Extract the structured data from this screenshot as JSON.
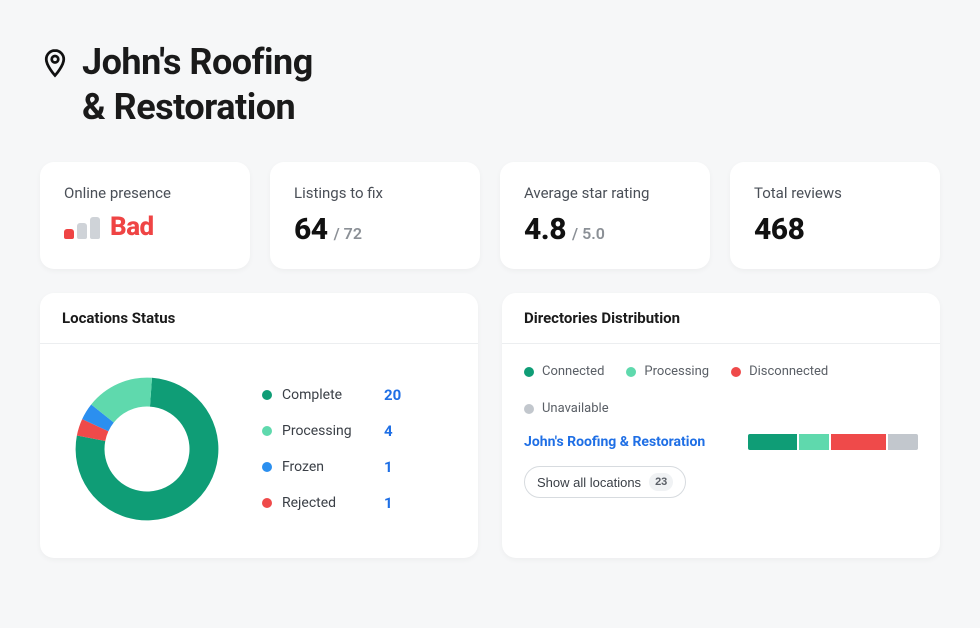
{
  "business": {
    "name_line1": "John's Roofing",
    "name_line2": "& Restoration"
  },
  "stats": {
    "online_presence": {
      "label": "Online presence",
      "status": "Bad"
    },
    "listings_to_fix": {
      "label": "Listings to fix",
      "value": "64",
      "of": "/ 72"
    },
    "avg_star": {
      "label": "Average star rating",
      "value": "4.8",
      "of": "/ 5.0"
    },
    "total_reviews": {
      "label": "Total reviews",
      "value": "468"
    }
  },
  "locations_status": {
    "title": "Locations Status",
    "items": [
      {
        "label": "Complete",
        "value": "20",
        "color": "#0f9d76"
      },
      {
        "label": "Processing",
        "value": "4",
        "color": "#5fd9ad"
      },
      {
        "label": "Frozen",
        "value": "1",
        "color": "#2b8fef"
      },
      {
        "label": "Rejected",
        "value": "1",
        "color": "#ef4a4a"
      }
    ]
  },
  "directories": {
    "title": "Directories Distribution",
    "legend": [
      {
        "label": "Connected",
        "color": "#0f9d76"
      },
      {
        "label": "Processing",
        "color": "#5fd9ad"
      },
      {
        "label": "Disconnected",
        "color": "#ef4a4a"
      },
      {
        "label": "Unavailable",
        "color": "#c2c7cd"
      }
    ],
    "row": {
      "name": "John's Roofing & Restoration",
      "segments": [
        {
          "color": "#0f9d76",
          "weight": 30
        },
        {
          "color": "#5fd9ad",
          "weight": 18
        },
        {
          "color": "#ef4a4a",
          "weight": 34
        },
        {
          "color": "#c2c7cd",
          "weight": 18
        }
      ]
    },
    "show_all": {
      "label": "Show all locations",
      "count": "23"
    }
  },
  "chart_data": {
    "type": "pie",
    "title": "Locations Status",
    "categories": [
      "Complete",
      "Processing",
      "Frozen",
      "Rejected"
    ],
    "values": [
      20,
      4,
      1,
      1
    ],
    "colors": [
      "#0f9d76",
      "#5fd9ad",
      "#2b8fef",
      "#ef4a4a"
    ]
  }
}
